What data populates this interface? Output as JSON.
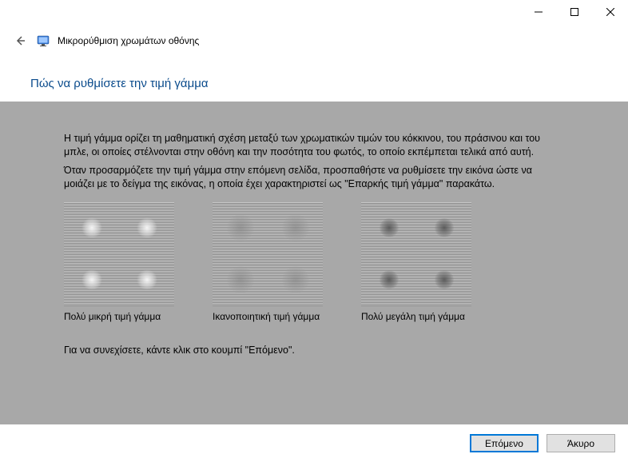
{
  "window": {
    "title": "Μικρορύθμιση χρωμάτων οθόνης"
  },
  "page": {
    "heading": "Πώς να ρυθμίσετε την τιμή γάμμα",
    "para1": "Η τιμή γάμμα ορίζει τη μαθηματική σχέση μεταξύ των χρωματικών τιμών του κόκκινου, του πράσινου και του μπλε, οι οποίες στέλνονται στην οθόνη και την ποσότητα του φωτός, το οποίο εκπέμπεται τελικά από αυτή.",
    "para2": "Όταν προσαρμόζετε την τιμή γάμμα στην επόμενη σελίδα, προσπαθήστε να ρυθμίσετε την εικόνα ώστε να μοιάζει με το δείγμα της εικόνας, η οποία έχει χαρακτηριστεί ως \"Επαρκής τιμή γάμμα\" παρακάτω.",
    "continueHint": "Για να συνεχίσετε, κάντε κλικ στο κουμπί \"Επόμενο\"."
  },
  "samples": {
    "low": "Πολύ μικρή τιμή γάμμα",
    "good": "Ικανοποιητική τιμή γάμμα",
    "high": "Πολύ μεγάλη τιμή γάμμα"
  },
  "buttons": {
    "next": "Επόμενο",
    "cancel": "Άκυρο"
  }
}
